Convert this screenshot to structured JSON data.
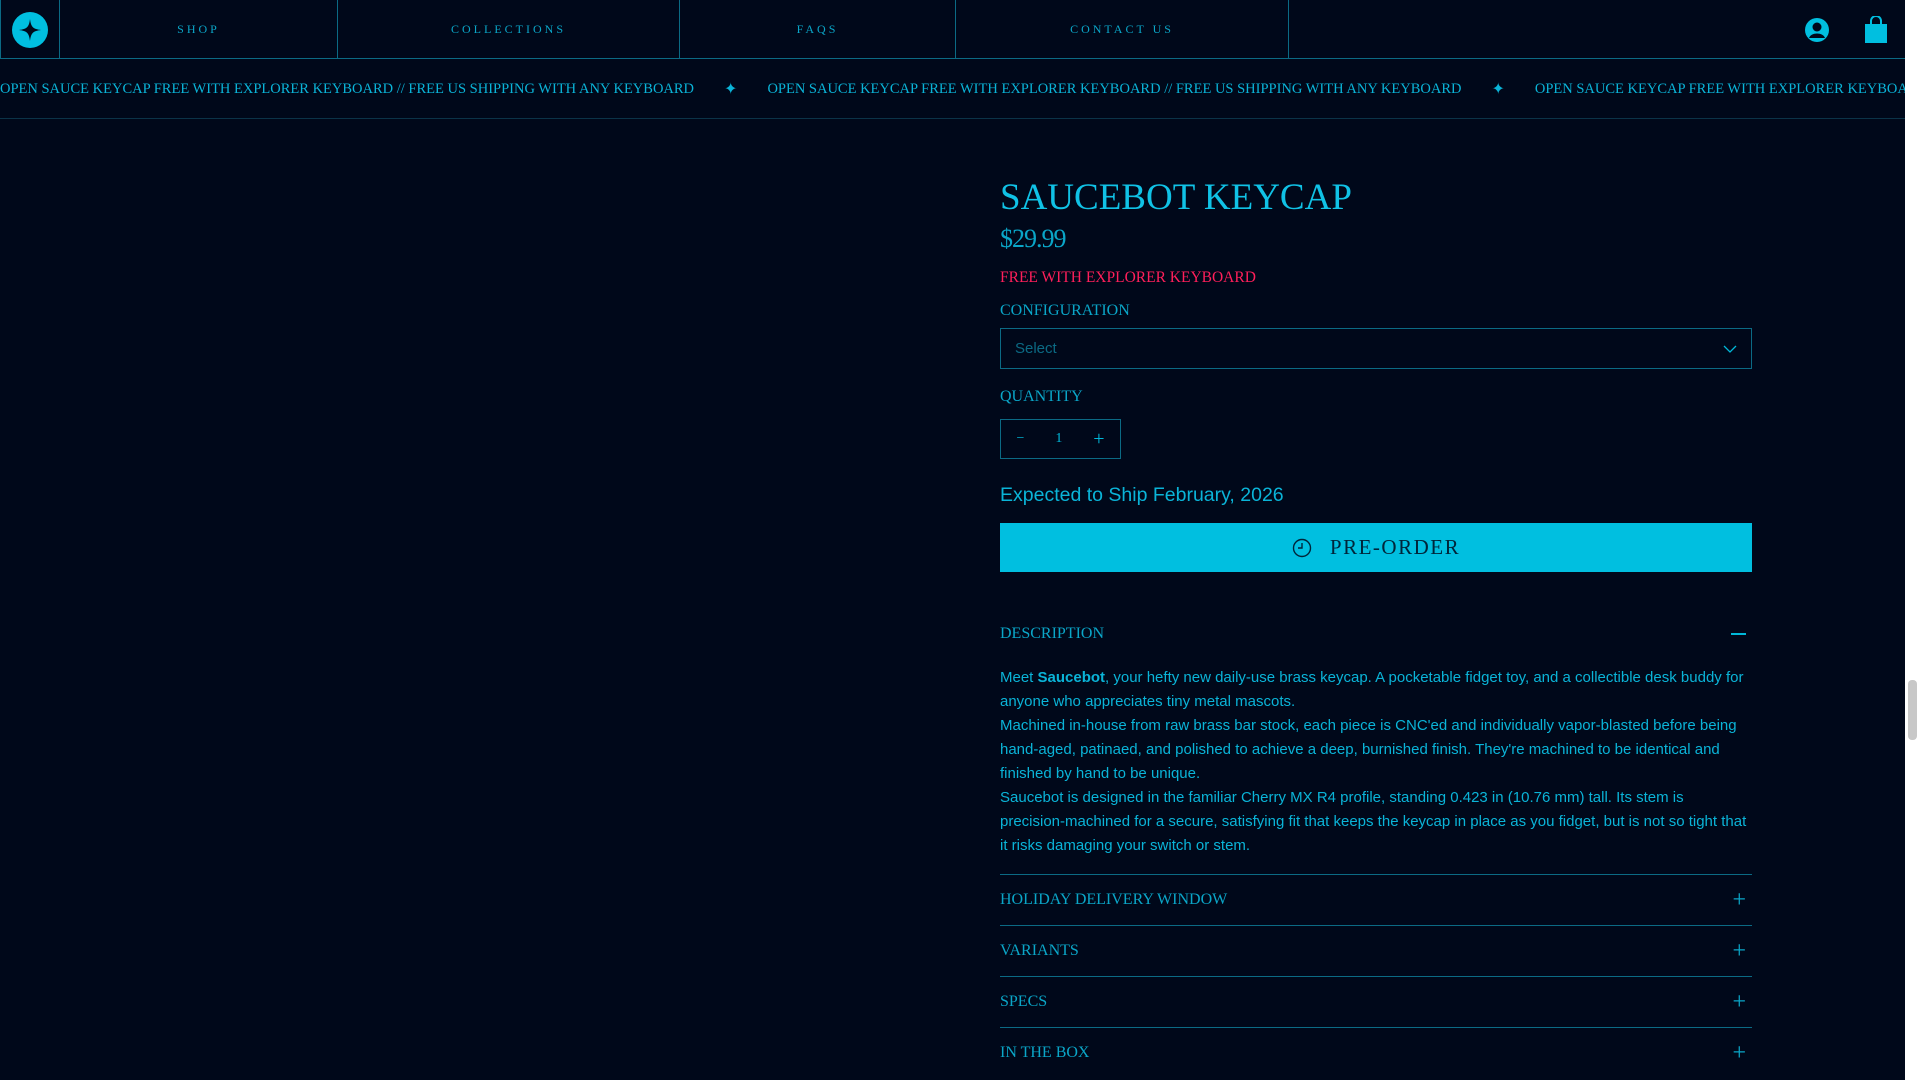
{
  "nav": {
    "items": [
      "SHOP",
      "COLLECTIONS",
      "FAQS",
      "CONTACT US"
    ]
  },
  "marquee": {
    "text": "OPEN SAUCE KEYCAP FREE WITH EXPLORER KEYBOARD // FREE US SHIPPING WITH ANY KEYBOARD",
    "separator": "✦"
  },
  "product": {
    "title": "SAUCEBOT KEYCAP",
    "price": "$29.99",
    "promo": "FREE WITH EXPLORER KEYBOARD",
    "configuration_label": "CONFIGURATION",
    "select_placeholder": "Select",
    "quantity_label": "QUANTITY",
    "quantity": "1",
    "minus": "−",
    "plus": "+",
    "shipping": "Expected to Ship February, 2026",
    "preorder_label": "PRE-ORDER"
  },
  "description": {
    "title": "DESCRIPTION",
    "p1_pre": "Meet ",
    "p1_bold": "Saucebot",
    "p1_post": ", your hefty new daily-use brass keycap. A pocketable fidget toy, and a collectible desk buddy for anyone who appreciates tiny metal mascots.",
    "p2": "Machined in-house from raw brass bar stock, each piece is CNC'ed and individually vapor-blasted before being hand-aged, patinaed, and polished to achieve a deep, burnished finish. They're machined to be identical and finished by hand to be unique.",
    "p3": "Saucebot is designed in the familiar Cherry MX R4 profile, standing 0.423 in (10.76 mm) tall. Its stem is precision-machined for a secure, satisfying fit that keeps the keycap in place as you fidget, but is not so tight that it risks damaging your switch or stem."
  },
  "accordions": [
    "HOLIDAY DELIVERY WINDOW",
    "VARIANTS",
    "SPECS",
    "IN THE BOX"
  ],
  "colors": {
    "bg": "#00081a",
    "accent": "#00bfe0",
    "promo": "#ff1f5a"
  }
}
